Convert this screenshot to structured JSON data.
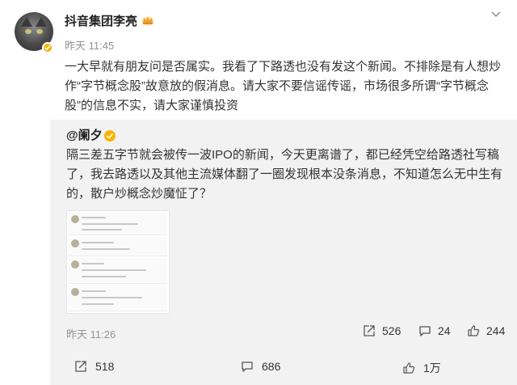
{
  "post": {
    "author": "抖音集团李亮",
    "time": "昨天 11:45",
    "text": "一大早就有朋友问是否属实。我看了下路透也没有发这个新闻。不排除是有人想炒作“字节概念股”故意放的假消息。请大家不要信谣传谣，市场很多所谓“字节概念股”的信息不实，请大家谨慎投资"
  },
  "repost": {
    "author": "@阑夕",
    "text": "隔三差五字节就会被传一波IPO的新闻，今天更离谱了，都已经凭空给路透社写稿了，我去路透以及其他主流媒体翻了一圈发现根本没条消息，不知道怎么无中生有的，散户炒概念炒魔怔了？",
    "time": "昨天 11:26",
    "reposts": "526",
    "comments": "24",
    "likes": "244"
  },
  "actions": {
    "reposts": "518",
    "comments": "686",
    "likes": "1万"
  },
  "icons": [
    "verified-badge-icon",
    "crown-icon",
    "chevron-down-icon",
    "share-icon",
    "comment-icon",
    "like-icon"
  ],
  "colors": {
    "badge": "#f7b500",
    "muted": "#939393",
    "repost_bg": "#f2f2f2"
  }
}
